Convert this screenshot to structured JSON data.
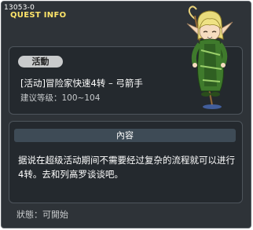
{
  "window": {
    "quest_id": "13053-0",
    "title": "QUEST INFO"
  },
  "quest": {
    "category_label": "活動",
    "name": "[活动]冒险家快速4转 – 弓箭手",
    "level_label": "建议等级：",
    "level_range": "100~104"
  },
  "content": {
    "header": "內容",
    "body": "据说在超级活动期间不需要经过复杂的流程就可以进行4转。去和列高罗谈谈吧。"
  },
  "status": {
    "label": "狀態：",
    "value": "可開始"
  },
  "npc": {
    "icon": "elf-archer-npc-icon"
  },
  "colors": {
    "window_bg": "#2e3338",
    "panel_bg": "#24292e",
    "title_accent": "#ffe56a",
    "pill_bg": "#c9cbcc",
    "content_header_bg": "#3e4b56"
  }
}
